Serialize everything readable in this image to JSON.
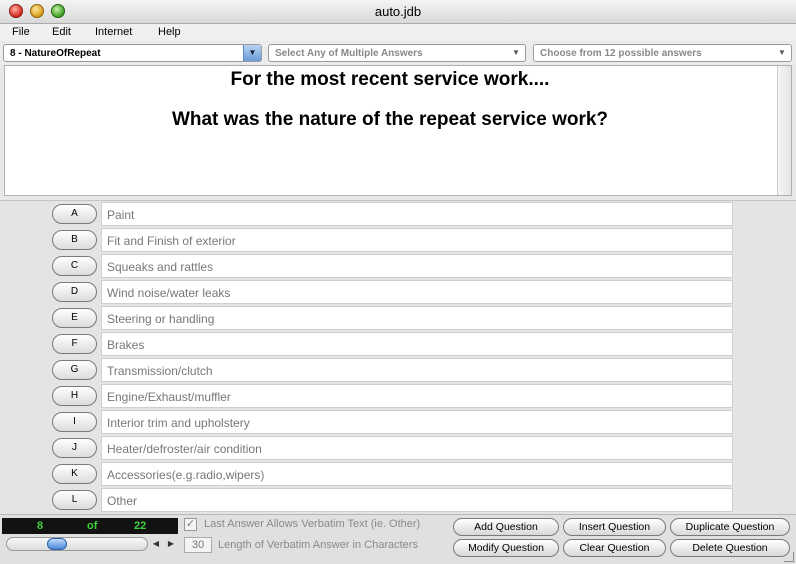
{
  "window": {
    "title": "auto.jdb"
  },
  "menu": [
    "File",
    "Edit",
    "Internet",
    "Help"
  ],
  "selectors": {
    "question": "8 - NatureOfRepeat",
    "answer_type": "Select Any of Multiple Answers",
    "answer_count": "Choose from 12 possible answers"
  },
  "question": {
    "title": "For the most recent service work....",
    "text": "What was the nature of the repeat service work?"
  },
  "answers": [
    {
      "key": "A",
      "text": "Paint"
    },
    {
      "key": "B",
      "text": "Fit and Finish of exterior"
    },
    {
      "key": "C",
      "text": "Squeaks and rattles"
    },
    {
      "key": "D",
      "text": "Wind noise/water leaks"
    },
    {
      "key": "E",
      "text": "Steering or handling"
    },
    {
      "key": "F",
      "text": "Brakes"
    },
    {
      "key": "G",
      "text": "Transmission/clutch"
    },
    {
      "key": "H",
      "text": "Engine/Exhaust/muffler"
    },
    {
      "key": "I",
      "text": "Interior trim and upholstery"
    },
    {
      "key": "J",
      "text": "Heater/defroster/air condition"
    },
    {
      "key": "K",
      "text": "Accessories(e.g.radio,wipers)"
    },
    {
      "key": "L",
      "text": "Other"
    }
  ],
  "navigator": {
    "current": "8",
    "of_label": "of",
    "total": "22",
    "position_fraction": 0.33
  },
  "options": {
    "verbatim_checkbox_label": "Last Answer Allows Verbatim Text (ie. Other)",
    "verbatim_checked": true,
    "verbatim_length": "30",
    "verbatim_length_label": "Length of Verbatim Answer in Characters"
  },
  "actions": {
    "add": "Add Question",
    "insert": "Insert Question",
    "duplicate": "Duplicate Question",
    "modify": "Modify Question",
    "clear": "Clear Question",
    "delete": "Delete Question"
  },
  "colors": {
    "counter_bg": "#121212",
    "counter_text": "#3fd23f",
    "accent": "#4a86d6"
  }
}
